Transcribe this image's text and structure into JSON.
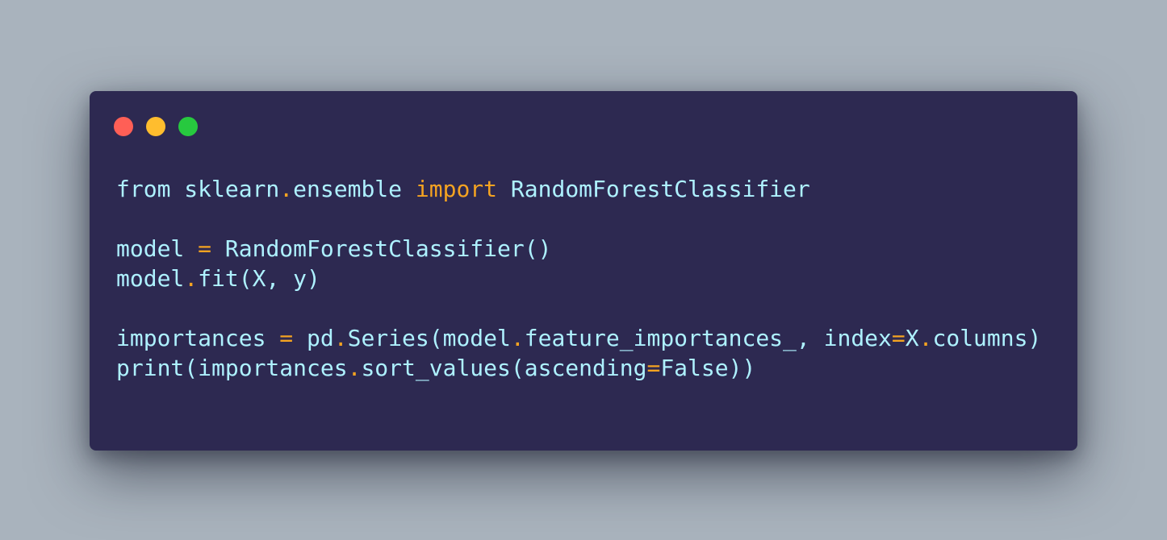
{
  "window_controls": [
    {
      "name": "close",
      "color": "#ff5f56"
    },
    {
      "name": "minimize",
      "color": "#ffbd2e"
    },
    {
      "name": "maximize",
      "color": "#27c93f"
    }
  ],
  "colors": {
    "background": "#a9b3bd",
    "window": "#2d2951",
    "text": "#aef1ff",
    "accent": "#f4a321"
  },
  "code_lines": [
    [
      {
        "t": "from sklearn",
        "k": "text"
      },
      {
        "t": ".",
        "k": "accent"
      },
      {
        "t": "ensemble ",
        "k": "text"
      },
      {
        "t": "import",
        "k": "accent"
      },
      {
        "t": " RandomForestClassifier",
        "k": "text"
      }
    ],
    [],
    [
      {
        "t": "model ",
        "k": "text"
      },
      {
        "t": "=",
        "k": "accent"
      },
      {
        "t": " RandomForestClassifier()",
        "k": "text"
      }
    ],
    [
      {
        "t": "model",
        "k": "text"
      },
      {
        "t": ".",
        "k": "accent"
      },
      {
        "t": "fit(X, y)",
        "k": "text"
      }
    ],
    [],
    [
      {
        "t": "importances ",
        "k": "text"
      },
      {
        "t": "=",
        "k": "accent"
      },
      {
        "t": " pd",
        "k": "text"
      },
      {
        "t": ".",
        "k": "accent"
      },
      {
        "t": "Series(model",
        "k": "text"
      },
      {
        "t": ".",
        "k": "accent"
      },
      {
        "t": "feature_importances_, index",
        "k": "text"
      },
      {
        "t": "=",
        "k": "accent"
      },
      {
        "t": "X",
        "k": "text"
      },
      {
        "t": ".",
        "k": "accent"
      },
      {
        "t": "columns)",
        "k": "text"
      }
    ],
    [
      {
        "t": "print(importances",
        "k": "text"
      },
      {
        "t": ".",
        "k": "accent"
      },
      {
        "t": "sort_values(ascending",
        "k": "text"
      },
      {
        "t": "=",
        "k": "accent"
      },
      {
        "t": "False))",
        "k": "text"
      }
    ]
  ]
}
